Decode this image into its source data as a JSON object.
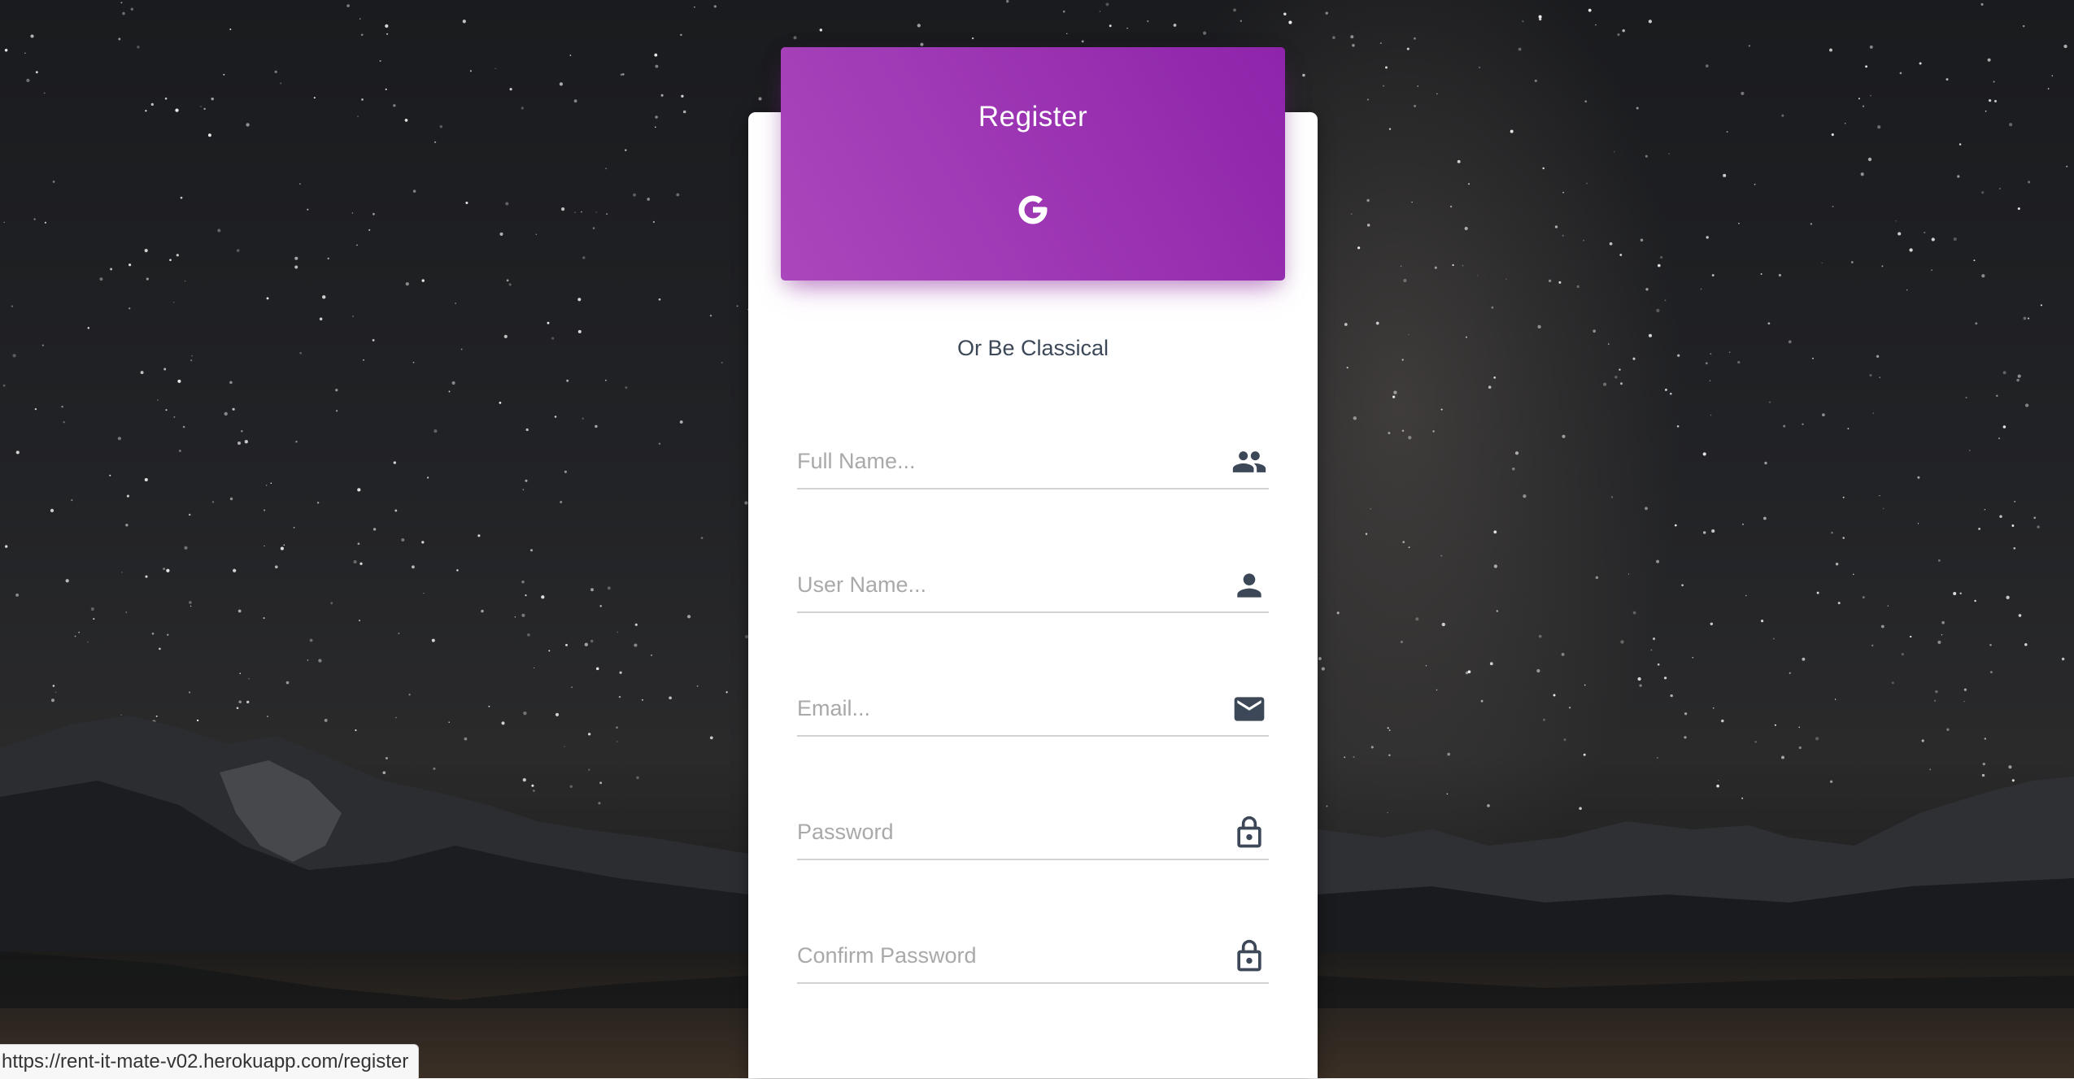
{
  "header": {
    "title": "Register",
    "social_icon": "google-icon"
  },
  "form": {
    "subtitle": "Or Be Classical",
    "fields": [
      {
        "placeholder": "Full Name...",
        "icon": "people-icon"
      },
      {
        "placeholder": "User Name...",
        "icon": "person-icon"
      },
      {
        "placeholder": "Email...",
        "icon": "mail-icon"
      },
      {
        "placeholder": "Password",
        "icon": "lock-icon"
      },
      {
        "placeholder": "Confirm Password",
        "icon": "lock-icon"
      }
    ]
  },
  "status_bar": {
    "url": "https://rent-it-mate-v02.herokuapp.com/register"
  },
  "colors": {
    "header_start": "#ab47bc",
    "header_end": "#8e24aa",
    "icon": "#3c4858"
  }
}
